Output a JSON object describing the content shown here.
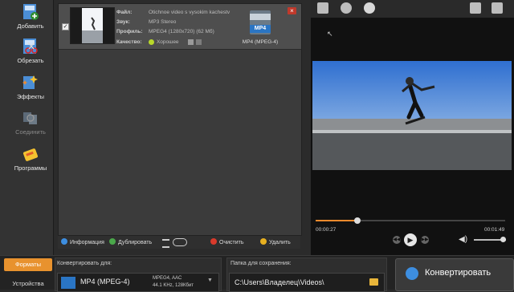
{
  "sidebar": {
    "items": [
      {
        "label": "Добавить",
        "icon": "add-video-icon"
      },
      {
        "label": "Обрезать",
        "icon": "trim-icon"
      },
      {
        "label": "Эффекты",
        "icon": "effects-icon"
      },
      {
        "label": "Соединить",
        "icon": "join-icon"
      },
      {
        "label": "Программы",
        "icon": "programs-icon"
      }
    ]
  },
  "file": {
    "checked": true,
    "labels": {
      "file": "Файл:",
      "sound": "Звук:",
      "profile": "Профиль:",
      "quality": "Качество:"
    },
    "values": {
      "file": "Otichnoe video s vysokim kachestv",
      "sound": "MP3 Stereo",
      "profile": "MPEG4 (1280x720) (62 Мб)",
      "quality": "Хорошее"
    },
    "format_badge": "MP4",
    "format_name": "MP4 (MPEG-4)"
  },
  "list_toolbar": {
    "info": "Информация",
    "duplicate": "Дублировать",
    "clear": "Очистить",
    "delete": "Удалить"
  },
  "player": {
    "time_current": "00:00:27",
    "time_total": "00:01:49",
    "progress": 0.22
  },
  "bottom": {
    "tabs": {
      "formats": "Форматы",
      "devices": "Устройства"
    },
    "convert_to_label": "Конвертировать для:",
    "format_value": "MP4 (MPEG-4)",
    "format_detail_1": "MPEG4, AAC",
    "format_detail_2": "44.1 KHz, 128Кбит",
    "save_folder_label": "Папка для сохранения:",
    "save_folder_value": "C:\\Users\\Владелец\\Videos\\",
    "convert_button": "Конвертировать"
  },
  "colors": {
    "accent": "#f08a2c",
    "tab_active": "#e8922e"
  }
}
